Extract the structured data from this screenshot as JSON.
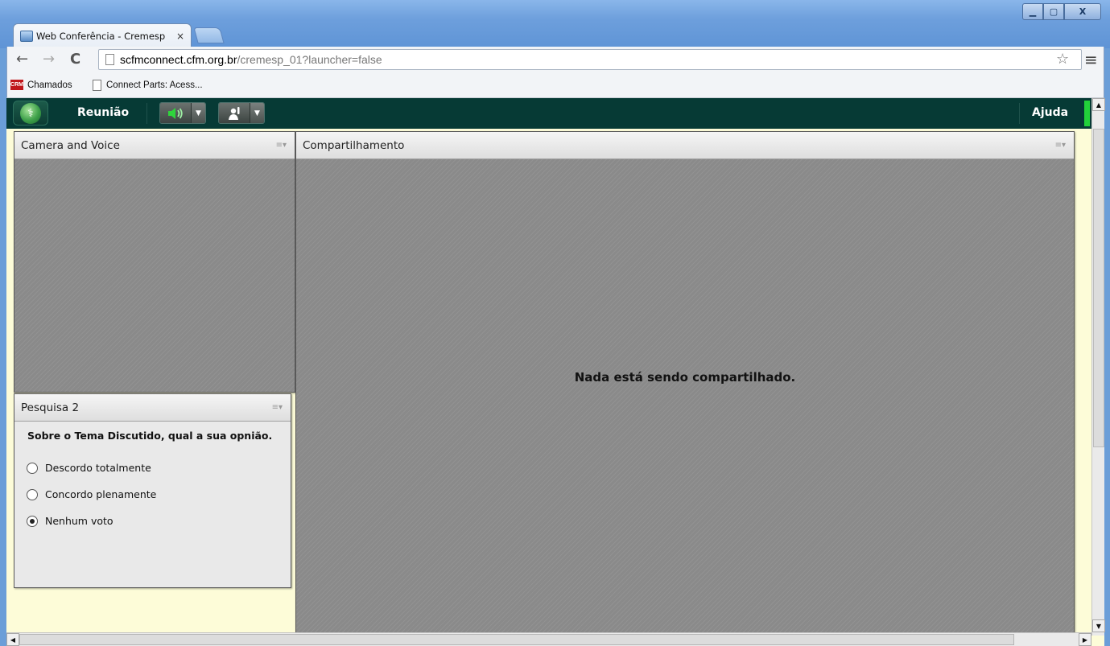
{
  "browser": {
    "tab_title": "Web Conferência - Cremesp",
    "tab_close": "×",
    "url_host": "scfmconnect.cfm.org.br",
    "url_path": "/cremesp_01?launcher=false",
    "bookmarks": [
      {
        "label": "Chamados",
        "icon": "crm-icon",
        "icon_text": "CRM"
      },
      {
        "label": "Connect Parts: Acess...",
        "icon": "page-icon"
      }
    ]
  },
  "app": {
    "menu_meeting": "Reunião",
    "menu_help": "Ajuda",
    "audio_button_icon": "speaker-icon",
    "status_button_icon": "raise-hand-icon",
    "status_level_color": "#22d13a"
  },
  "pods": {
    "camera": {
      "title": "Camera and Voice"
    },
    "share": {
      "title": "Compartilhamento",
      "empty_message": "Nada está sendo compartilhado."
    },
    "poll": {
      "title": "Pesquisa 2",
      "question": "Sobre o Tema Discutido, qual a sua opnião.",
      "options": [
        {
          "label": "Descordo totalmente",
          "selected": false
        },
        {
          "label": "Concordo plenamente",
          "selected": false
        },
        {
          "label": "Nenhum voto",
          "selected": true
        }
      ]
    }
  },
  "colors": {
    "app_header": "#063a35",
    "app_background": "#fdfcd8",
    "pod_content": "#8a8a8a"
  }
}
